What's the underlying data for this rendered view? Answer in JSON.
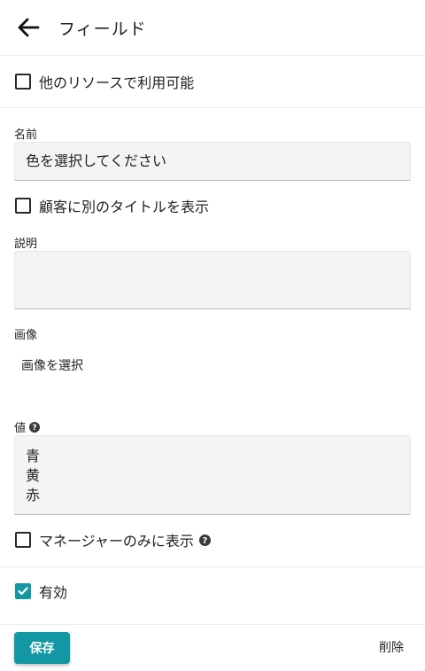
{
  "header": {
    "title": "フィールド",
    "back_icon": "arrow-left-icon"
  },
  "options": {
    "available_other_resources": "他のリソースで利用可能"
  },
  "name_field": {
    "label": "名前",
    "value": "色を選択してください"
  },
  "show_customer_title": {
    "label": "顧客に別のタイトルを表示"
  },
  "description_field": {
    "label": "説明",
    "value": ""
  },
  "image_field": {
    "label": "画像",
    "select_label": "画像を選択"
  },
  "values_field": {
    "label": "値",
    "lines": [
      "青",
      "黄",
      "赤"
    ]
  },
  "managers_only": {
    "label": "マネージャーのみに表示"
  },
  "enabled": {
    "label": "有効",
    "checked": true
  },
  "actions": {
    "save_label": "保存",
    "delete_label": "削除"
  },
  "colors": {
    "accent": "#1397a3"
  }
}
